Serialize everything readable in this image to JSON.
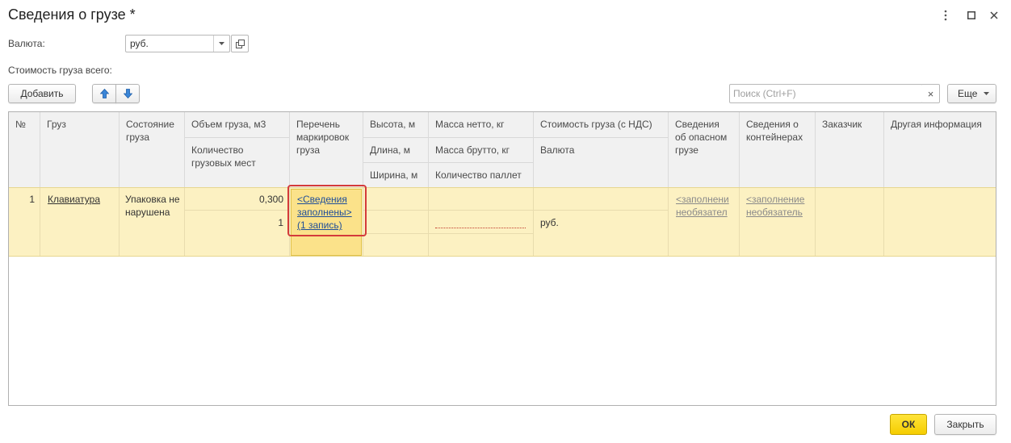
{
  "window": {
    "title": "Сведения о грузе *",
    "controls": [
      "more-icon",
      "maximize-icon",
      "close-icon"
    ]
  },
  "form": {
    "currency_label": "Валюта:",
    "currency_value": "руб.",
    "total_cost_label": "Стоимость груза всего:"
  },
  "toolbar": {
    "add_label": "Добавить",
    "search_placeholder": "Поиск (Ctrl+F)",
    "clear_symbol": "×",
    "more_label": "Еще"
  },
  "table": {
    "headers": {
      "num": "№",
      "cargo": "Груз",
      "state": "Состояние груза",
      "volume": "Объем груза, м3",
      "places": "Количество грузовых мест",
      "markings": "Перечень маркировок груза",
      "height": "Высота, м",
      "length": "Длина, м",
      "width": "Ширина, м",
      "net": "Масса нетто, кг",
      "gross": "Масса брутто, кг",
      "pallets": "Количество паллет",
      "cost": "Стоимость груза (с НДС)",
      "currency": "Валюта",
      "danger": "Сведения об опасном грузе",
      "containers": "Сведения о контейнерах",
      "customer": "Заказчик",
      "other": "Другая информация"
    },
    "rows": [
      {
        "num": "1",
        "cargo": "Клавиатура",
        "state": "Упаковка не нарушена",
        "volume": "0,300",
        "places": "1",
        "markings_line1": "<Сведения",
        "markings_line2": "заполнены>",
        "markings_line3": "(1 запись)",
        "currency": "руб.",
        "danger_line1": "<заполнени",
        "danger_line2": "необязател",
        "containers_line1": "<заполнение",
        "containers_line2": "необязатель"
      }
    ]
  },
  "footer": {
    "ok_label": "ОК",
    "close_label": "Закрыть"
  },
  "colors": {
    "selected_row": "#fcf1c2",
    "selected_cell": "#fbe28a",
    "highlight_border": "#d43b3b",
    "ok_button": "#f5cd00",
    "link": "#1f4e99"
  }
}
